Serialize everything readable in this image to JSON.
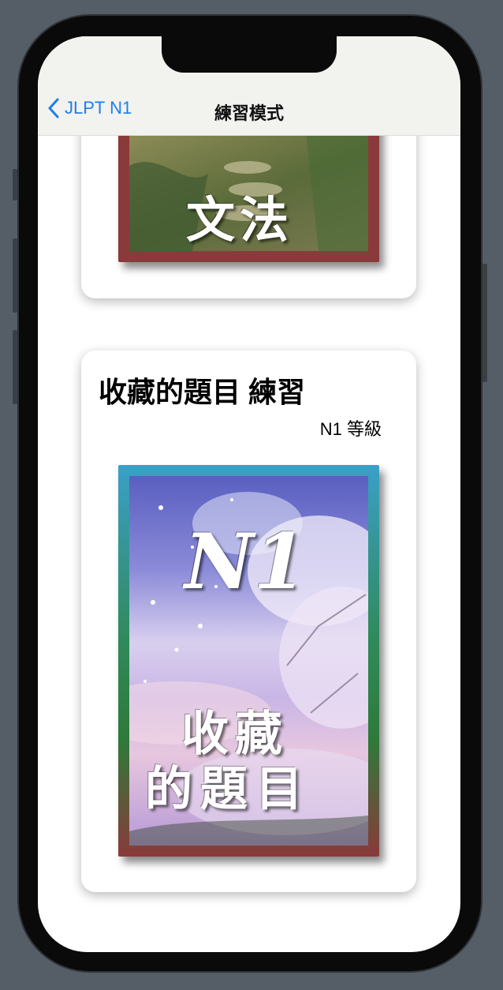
{
  "nav": {
    "back_label": "JLPT N1",
    "title": "練習模式"
  },
  "grammar_card": {
    "cover_text": "文法",
    "cover_border_color": "#8a3a3a"
  },
  "favorites_card": {
    "title": "收藏的題目 練習",
    "level": "N1 等級",
    "cover": {
      "badge": "N1",
      "line1": "收藏",
      "line2": "的題目"
    }
  },
  "colors": {
    "accent": "#1b7ff0",
    "card_bg": "#ffffff",
    "navbar_bg": "#f2f2ee"
  }
}
